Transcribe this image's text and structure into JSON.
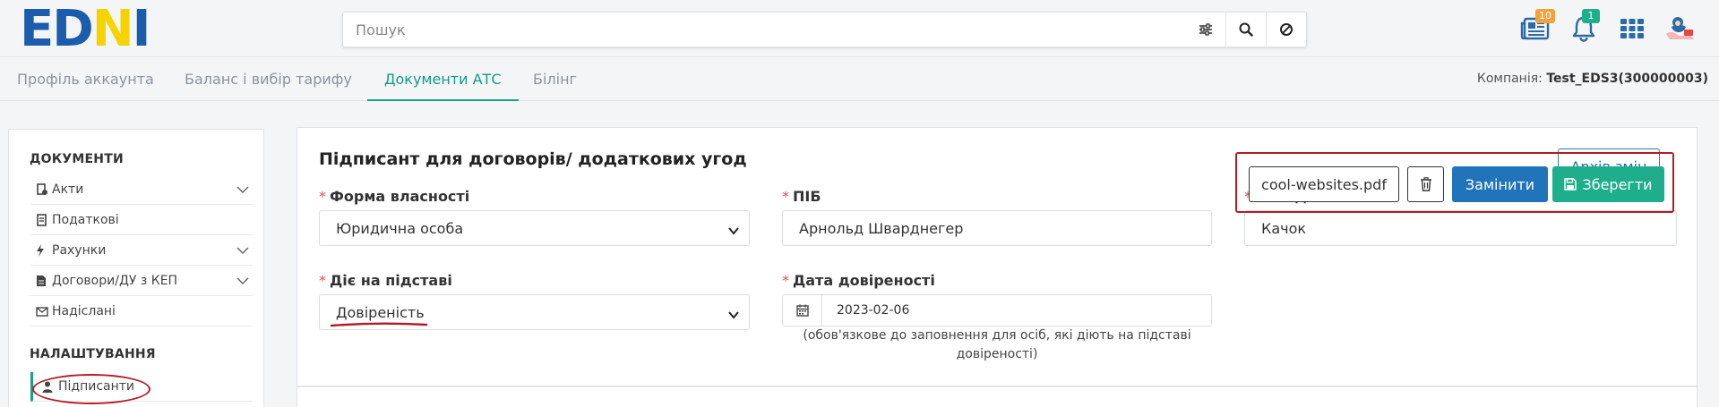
{
  "header": {
    "logo": {
      "part1": "ED",
      "part2": "N",
      "part3": "I"
    },
    "search": {
      "placeholder": "Пошук",
      "value": ""
    },
    "icons": {
      "news": {
        "name": "newspaper-icon",
        "badge": "10",
        "badge_color": "#f0a23b"
      },
      "bell": {
        "name": "bell-icon",
        "badge": "1",
        "badge_color": "#1fae8c"
      },
      "apps": {
        "name": "grid-icon"
      },
      "avatar": {
        "name": "avatar"
      }
    }
  },
  "tabs": [
    {
      "label": "Профіль аккаунта",
      "active": false
    },
    {
      "label": "Баланс і вибір тарифу",
      "active": false
    },
    {
      "label": "Документи АТС",
      "active": true
    },
    {
      "label": "Білінг",
      "active": false
    }
  ],
  "company": {
    "prefix": "Компанія:",
    "value": "Test_EDS3(300000003)"
  },
  "sidebar": {
    "documents_heading": "ДОКУМЕНТИ",
    "documents": [
      {
        "label": "Акти",
        "icon": "file-check-icon",
        "expandable": true
      },
      {
        "label": "Податкові",
        "icon": "tax-doc-icon",
        "expandable": false
      },
      {
        "label": "Рахунки",
        "icon": "bolt-icon",
        "expandable": true
      },
      {
        "label": "Договори/ДУ з КЕП",
        "icon": "document-icon",
        "expandable": true
      },
      {
        "label": "Надіслані",
        "icon": "envelope-icon",
        "expandable": false
      }
    ],
    "settings_heading": "НАЛАШТУВАННЯ",
    "settings": [
      {
        "label": "Підписанти",
        "icon": "user-icon",
        "active": true
      }
    ]
  },
  "form": {
    "title": "Підписант для договорів/ додаткових угод",
    "archive_button": "Архів змін",
    "ownership": {
      "label": "Форма власності",
      "value": "Юридична особа"
    },
    "full_name": {
      "label": "ПІБ",
      "value": "Арнольд Шварднегер"
    },
    "position": {
      "label": "Посада",
      "value": "Качок"
    },
    "basis": {
      "label": "Діє на підставі",
      "value": "Довіреність"
    },
    "poa_date": {
      "label": "Дата довіреності",
      "value": "2023-02-06",
      "hint_line1": "(обов'язкове до заповнення для осіб, які діють на підставі",
      "hint_line2": "довіреності)"
    },
    "file": {
      "name": "cool-websites.pdf",
      "replace_button": "Замінити",
      "save_button": "Зберегти"
    }
  },
  "colors": {
    "accent_green": "#17a388",
    "primary_blue": "#2174ba",
    "annotation_red": "#b31c25",
    "required_red": "#d9534f"
  }
}
